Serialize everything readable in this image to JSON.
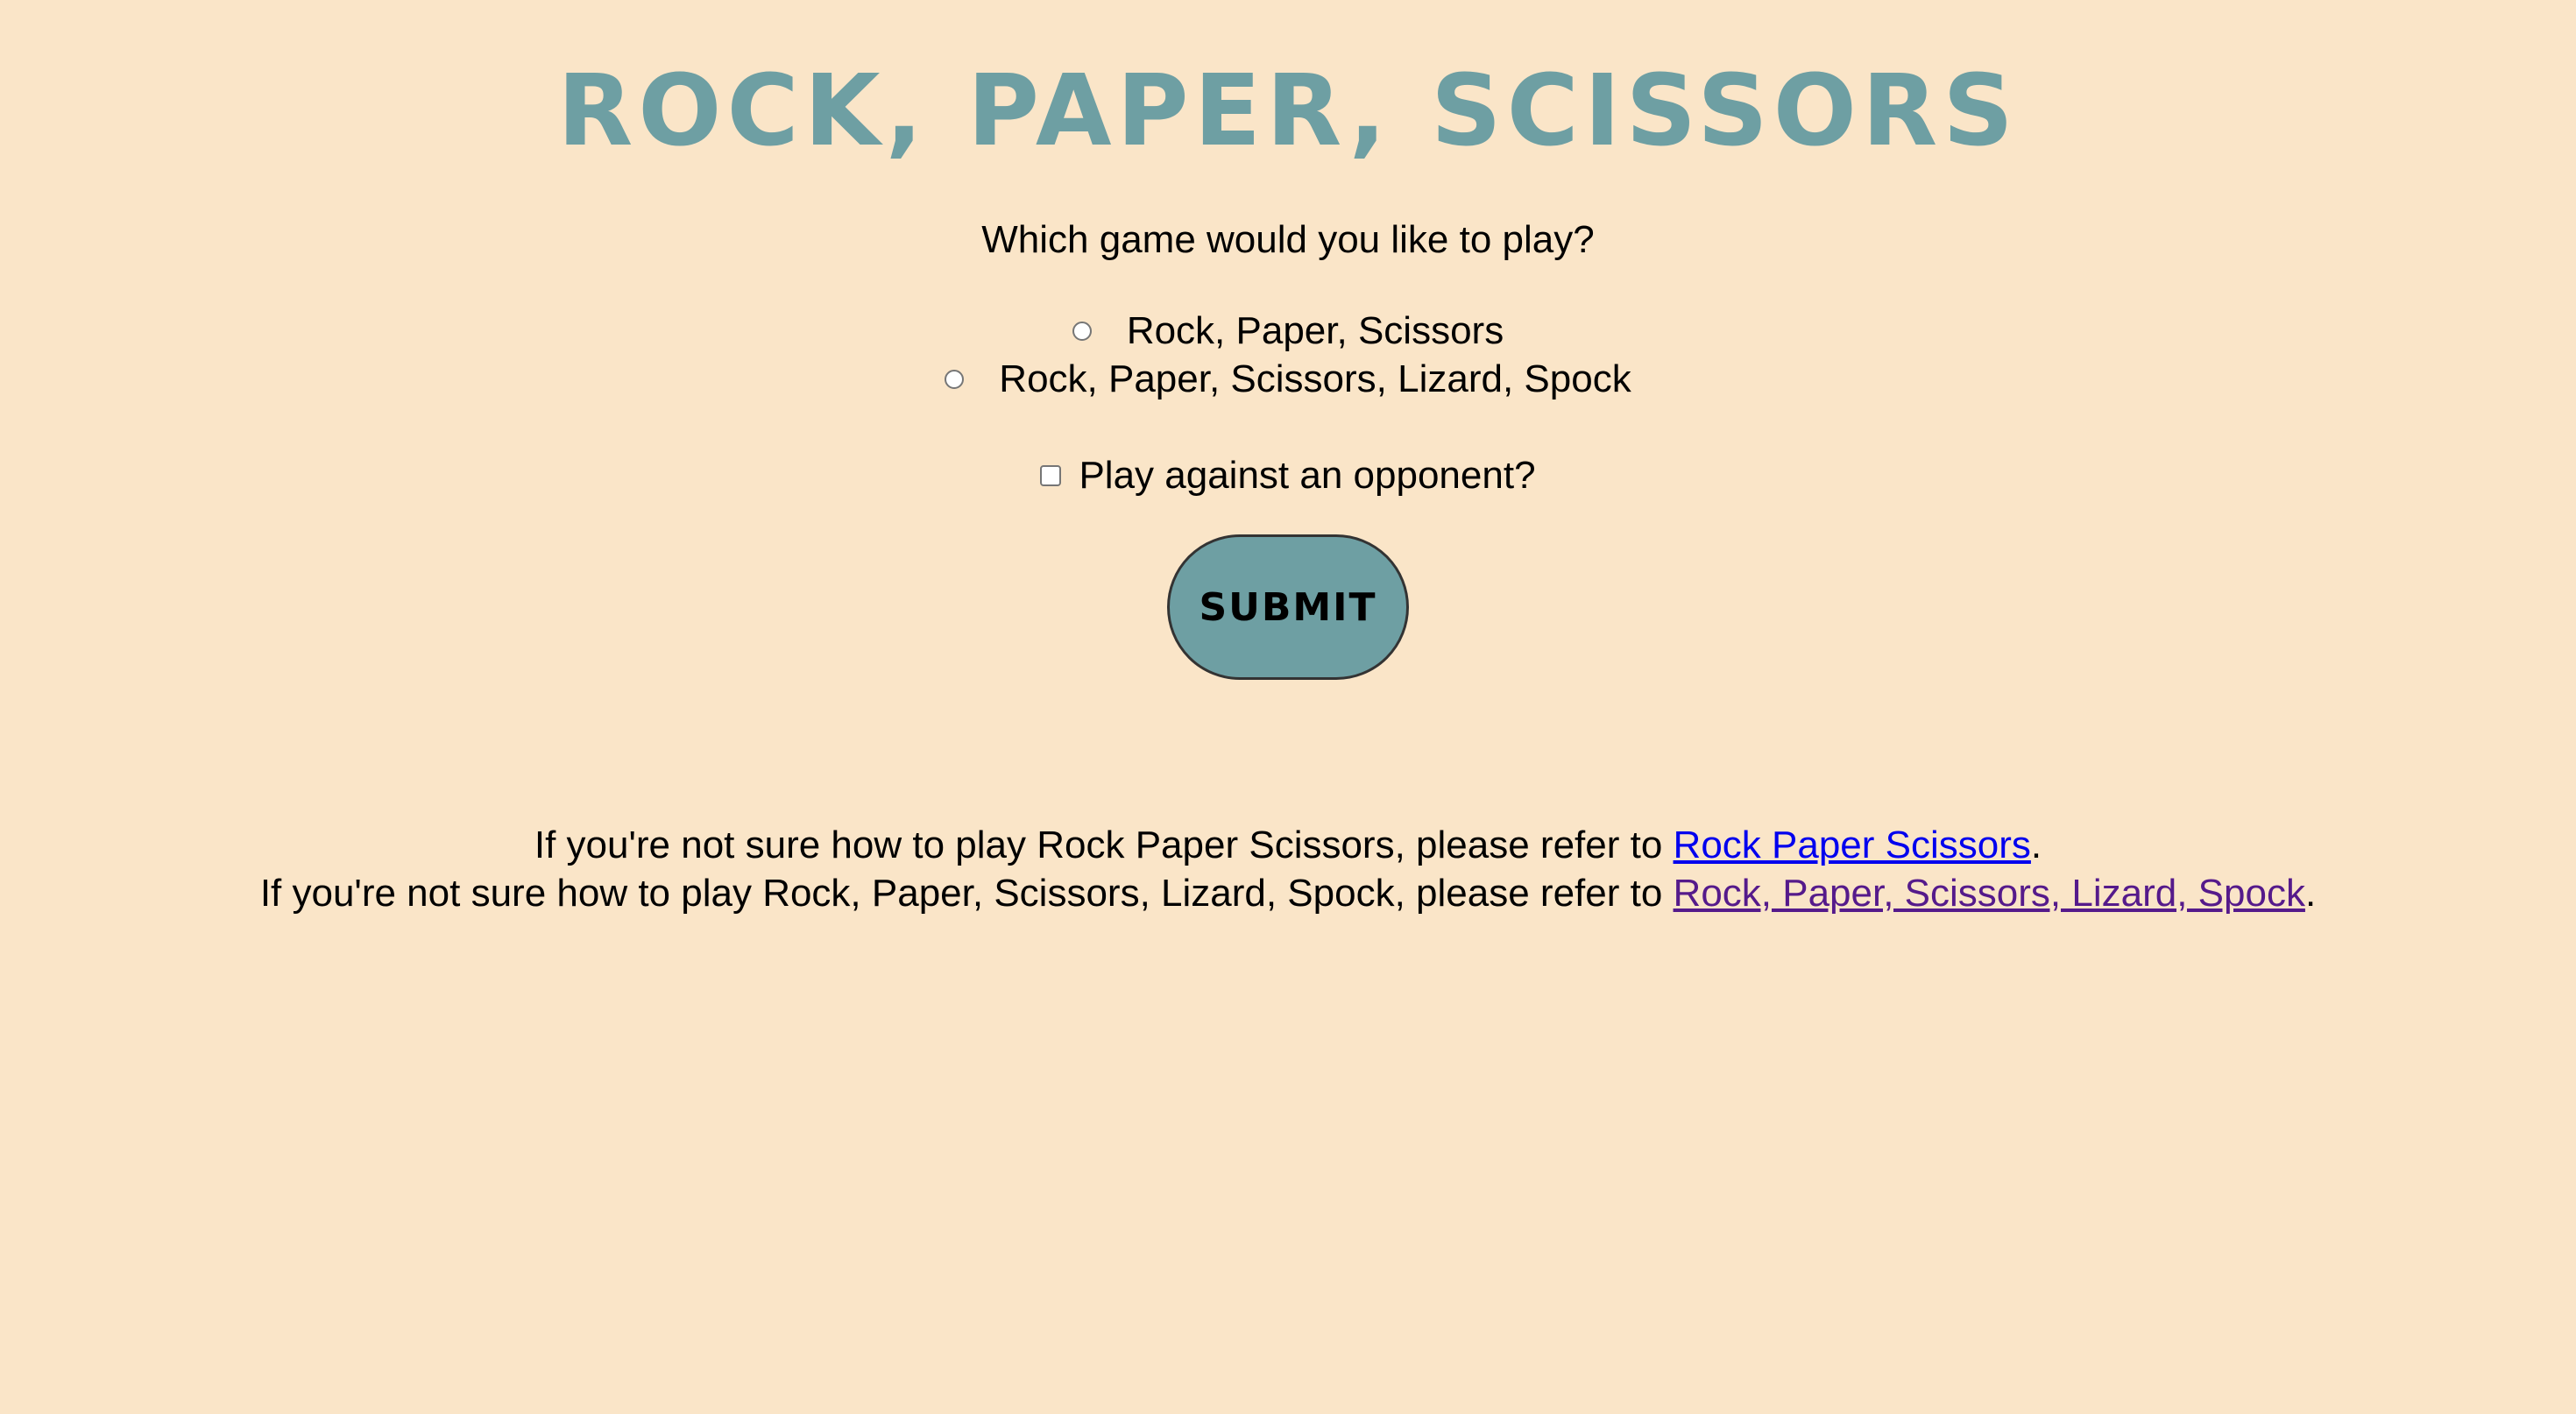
{
  "title": "Rock, Paper, Scissors",
  "question": "Which game would you like to play?",
  "options": [
    {
      "label": "Rock, Paper, Scissors",
      "selected": false
    },
    {
      "label": "Rock, Paper, Scissors, Lizard, Spock",
      "selected": false
    }
  ],
  "opponent": {
    "label": "Play against an opponent?",
    "checked": false
  },
  "submit": {
    "label": "SUBMIT"
  },
  "help": [
    {
      "prefix": "If you're not sure how to play Rock Paper Scissors, please refer to ",
      "link_text": "Rock Paper Scissors",
      "suffix": "."
    },
    {
      "prefix": "If you're not sure how to play Rock, Paper, Scissors, Lizard, Spock, please refer to ",
      "link_text": "Rock, Paper, Scissors, Lizard, Spock",
      "suffix": "."
    }
  ],
  "colors": {
    "background": "#fae5c8",
    "accent": "#6e9fa3",
    "link": "#0000ee",
    "link_visited": "#551a8b"
  }
}
